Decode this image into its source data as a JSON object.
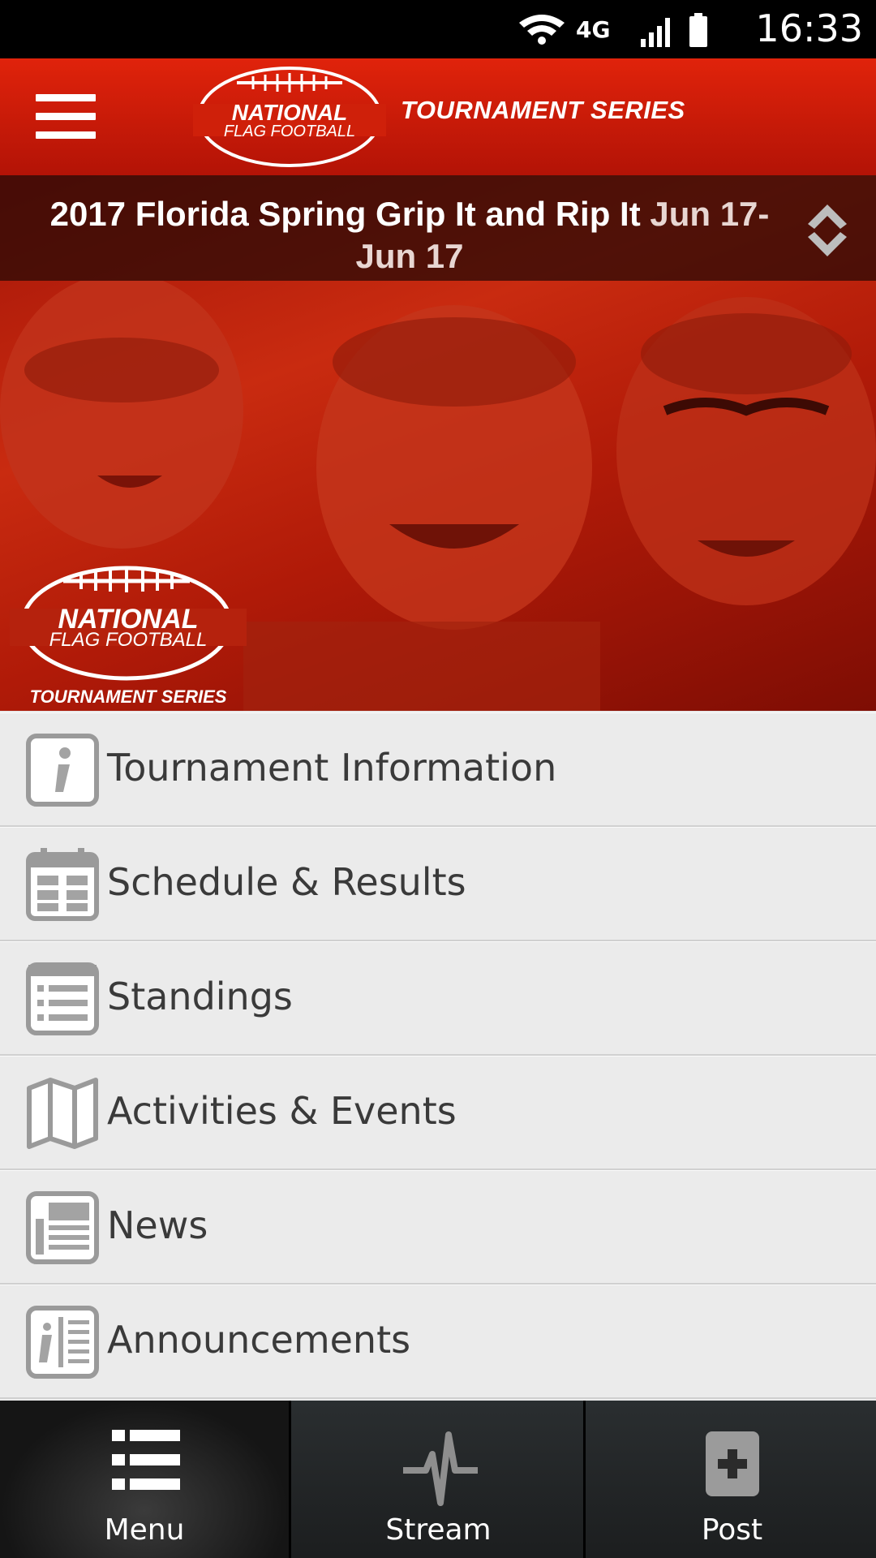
{
  "status_bar": {
    "time": "16:33",
    "network": "4G"
  },
  "header": {
    "logo_text_line1": "NATIONAL",
    "logo_text_line2": "FLAG FOOTBALL",
    "series_label": "TOURNAMENT SERIES"
  },
  "event": {
    "name": "2017 Florida Spring Grip It and Rip It",
    "date": "Jun 17-Jun 17"
  },
  "hero_logo": {
    "line1": "NATIONAL",
    "line2": "FLAG FOOTBALL",
    "line3": "TOURNAMENT SERIES"
  },
  "menu": {
    "items": [
      {
        "label": "Tournament Information",
        "icon": "info-icon"
      },
      {
        "label": "Schedule & Results",
        "icon": "calendar-icon"
      },
      {
        "label": "Standings",
        "icon": "list-icon"
      },
      {
        "label": "Activities & Events",
        "icon": "map-icon"
      },
      {
        "label": "News",
        "icon": "newspaper-icon"
      },
      {
        "label": "Announcements",
        "icon": "announcement-icon"
      }
    ]
  },
  "tabs": [
    {
      "label": "Menu",
      "icon": "list-menu-icon",
      "active": true
    },
    {
      "label": "Stream",
      "icon": "pulse-icon",
      "active": false
    },
    {
      "label": "Post",
      "icon": "plus-box-icon",
      "active": false
    }
  ],
  "colors": {
    "brand_red": "#d41f0a",
    "list_bg": "#ebebeb",
    "text": "#3a3a3a",
    "tabbar": "#1c1c1c"
  }
}
